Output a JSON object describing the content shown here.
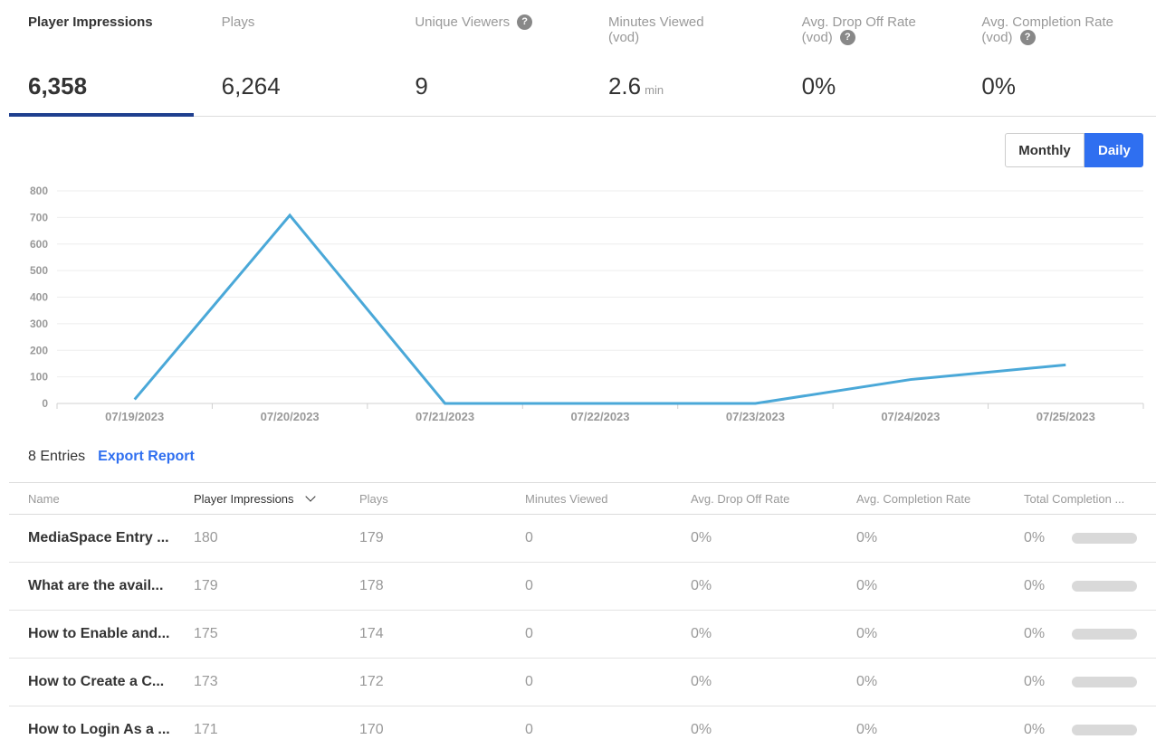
{
  "metrics": [
    {
      "label": "Player Impressions",
      "value": "6,358",
      "unit": "",
      "help": false,
      "label2": ""
    },
    {
      "label": "Plays",
      "value": "6,264",
      "unit": "",
      "help": false,
      "label2": ""
    },
    {
      "label": "Unique Viewers",
      "value": "9",
      "unit": "",
      "help": true,
      "label2": ""
    },
    {
      "label": "Minutes Viewed",
      "value": "2.6",
      "unit": "min",
      "help": false,
      "label2": "(vod)"
    },
    {
      "label": "Avg. Drop Off Rate",
      "value": "0%",
      "unit": "",
      "help": true,
      "label2": "(vod)"
    },
    {
      "label": "Avg. Completion Rate",
      "value": "0%",
      "unit": "",
      "help": true,
      "label2": "(vod)"
    }
  ],
  "toggle": {
    "monthly": "Monthly",
    "daily": "Daily"
  },
  "chart_data": {
    "type": "line",
    "x": [
      "07/19/2023",
      "07/20/2023",
      "07/21/2023",
      "07/22/2023",
      "07/23/2023",
      "07/24/2023",
      "07/25/2023"
    ],
    "series": [
      {
        "values": [
          15,
          708,
          0,
          0,
          0,
          90,
          145
        ]
      }
    ],
    "yticks": [
      0,
      100,
      200,
      300,
      400,
      500,
      600,
      700,
      800
    ],
    "ylim": [
      0,
      800
    ],
    "grid": true,
    "color": "#4aa8d8"
  },
  "entries": {
    "count": "8 Entries",
    "export": "Export Report"
  },
  "table": {
    "headers": [
      "Name",
      "Player Impressions",
      "Plays",
      "Minutes Viewed",
      "Avg. Drop Off Rate",
      "Avg. Completion Rate",
      "Total Completion ..."
    ],
    "rows": [
      [
        "MediaSpace Entry ...",
        "180",
        "179",
        "0",
        "0%",
        "0%",
        "0%"
      ],
      [
        "What are the avail...",
        "179",
        "178",
        "0",
        "0%",
        "0%",
        "0%"
      ],
      [
        "How to Enable and...",
        "175",
        "174",
        "0",
        "0%",
        "0%",
        "0%"
      ],
      [
        "How to Create a C...",
        "173",
        "172",
        "0",
        "0%",
        "0%",
        "0%"
      ],
      [
        "How to Login As a ...",
        "171",
        "170",
        "0",
        "0%",
        "0%",
        "0%"
      ]
    ]
  }
}
